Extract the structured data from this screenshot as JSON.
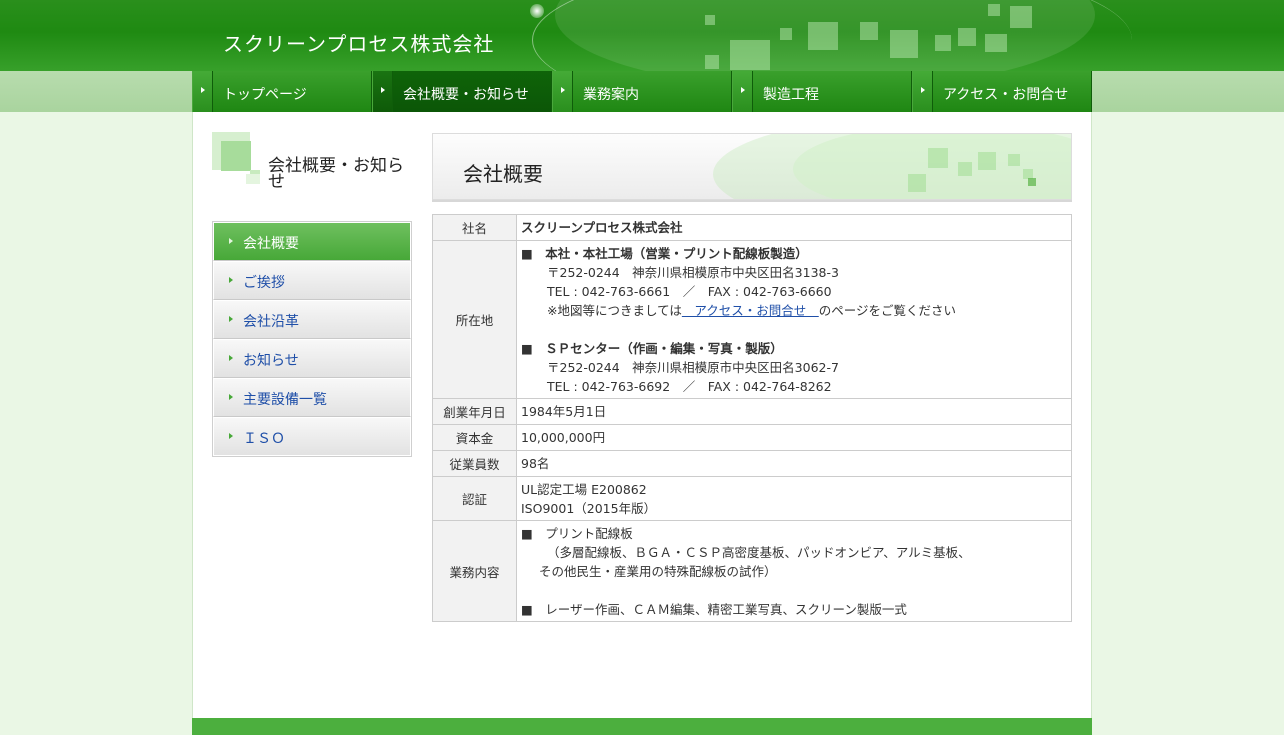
{
  "header": {
    "site_title": "スクリーンプロセス株式会社"
  },
  "nav": {
    "items": [
      {
        "label": "トップページ"
      },
      {
        "label": "会社概要・お知らせ"
      },
      {
        "label": "業務案内"
      },
      {
        "label": "製造工程"
      },
      {
        "label": "アクセス・お問合せ"
      }
    ],
    "active_index": 1
  },
  "sidebar": {
    "title": "会社概要・お知らせ",
    "items": [
      {
        "label": "会社概要"
      },
      {
        "label": "ご挨拶"
      },
      {
        "label": "会社沿革"
      },
      {
        "label": "お知らせ"
      },
      {
        "label": "主要設備一覧"
      },
      {
        "label": "ＩＳＯ"
      }
    ],
    "active_index": 0
  },
  "main": {
    "title": "会社概要",
    "table": {
      "company_name": {
        "label": "社名",
        "value": "スクリーンプロセス株式会社"
      },
      "location": {
        "label": "所在地",
        "head_office": {
          "heading": "■　本社・本社工場（営業・プリント配線板製造）",
          "address": "〒252-0244　神奈川県相模原市中央区田名3138-3",
          "phone": "TEL : 042-763-6661　／　FAX : 042-763-6660",
          "map_note_before": "※地図等につきましては",
          "map_link": "　アクセス・お問合せ　",
          "map_note_after": "のページをご覧ください"
        },
        "sp_center": {
          "heading": "■　ＳＰセンター（作画・編集・写真・製版）",
          "address": "〒252-0244　神奈川県相模原市中央区田名3062-7",
          "phone": "TEL : 042-763-6692　／　FAX : 042-764-8262"
        }
      },
      "founded": {
        "label": "創業年月日",
        "value": "1984年5月1日"
      },
      "capital": {
        "label": "資本金",
        "value": "10,000,000円"
      },
      "employees": {
        "label": "従業員数",
        "value": "98名"
      },
      "certification": {
        "label": "認証",
        "lines": [
          "UL認定工場 E200862",
          "ISO9001（2015年版）"
        ]
      },
      "business": {
        "label": "業務内容",
        "line1": "■　プリント配線板",
        "line2": "（多層配線板、ＢＧＡ・ＣＳＰ高密度基板、パッドオンビア、アルミ基板、",
        "line3": "その他民生・産業用の特殊配線板の試作）",
        "line4": "■　レーザー作画、ＣＡＭ編集、精密工業写真、スクリーン製版一式"
      }
    }
  },
  "colors": {
    "header_green": "#1f8a12",
    "nav_active": "#0f6409",
    "sidebar_active": "#47a838",
    "link_blue": "#1f4fa8"
  }
}
